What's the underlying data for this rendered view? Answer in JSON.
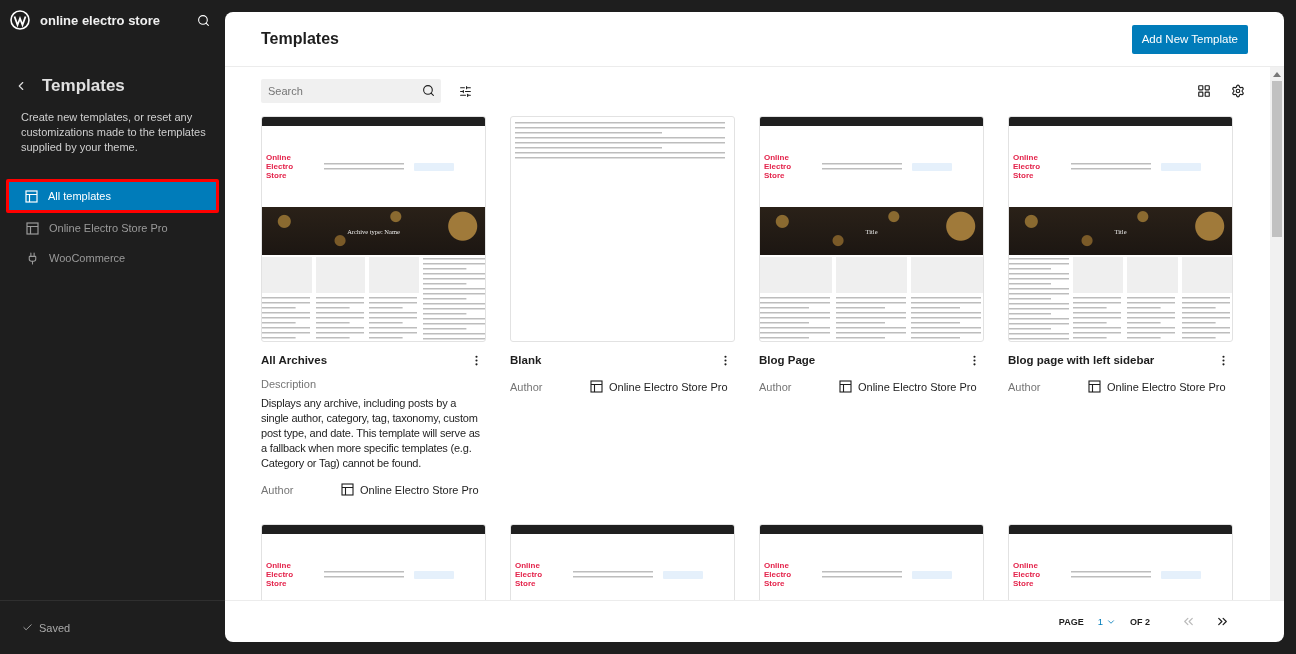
{
  "sidebar": {
    "site_title": "online electro store",
    "heading": "Templates",
    "description": "Create new templates, or reset any customizations made to the templates supplied by your theme.",
    "items": [
      {
        "label": "All templates",
        "kind": "layout",
        "selected": true
      },
      {
        "label": "Online Electro Store Pro",
        "kind": "layout",
        "selected": false
      },
      {
        "label": "WooCommerce",
        "kind": "plug",
        "selected": false
      }
    ],
    "status": "Saved"
  },
  "main": {
    "title": "Templates",
    "add_button": "Add New Template",
    "search": {
      "placeholder": "Search"
    },
    "templates": [
      {
        "title": "All Archives",
        "description_label": "Description",
        "description": "Displays any archive, including posts by a single author, category, tag, taxonomy, custom post type, and date. This template will serve as a fallback when more specific templates (e.g. Category or Tag) cannot be found.",
        "author_label": "Author",
        "author": "Online Electro Store Pro",
        "preview": {
          "kind": "archive",
          "logo": "Online Electro Store",
          "banner": "Archive type: Name"
        }
      },
      {
        "title": "Blank",
        "author_label": "Author",
        "author": "Online Electro Store Pro",
        "preview": {
          "kind": "blank"
        }
      },
      {
        "title": "Blog Page",
        "author_label": "Author",
        "author": "Online Electro Store Pro",
        "preview": {
          "kind": "blog",
          "logo": "Online Electro Store",
          "banner": "Title"
        }
      },
      {
        "title": "Blog page with left sidebar",
        "author_label": "Author",
        "author": "Online Electro Store Pro",
        "preview": {
          "kind": "left-sidebar",
          "logo": "Online Electro Store",
          "banner": "Title"
        }
      },
      {
        "preview": {
          "kind": "header",
          "logo": "Online Electro Store"
        }
      },
      {
        "preview": {
          "kind": "header",
          "logo": "Online Electro Store"
        }
      },
      {
        "preview": {
          "kind": "header",
          "logo": "Online Electro Store"
        }
      },
      {
        "preview": {
          "kind": "header",
          "logo": "Online Electro Store"
        }
      }
    ],
    "pagination": {
      "label": "PAGE",
      "current": "1",
      "total": "OF 2"
    }
  }
}
